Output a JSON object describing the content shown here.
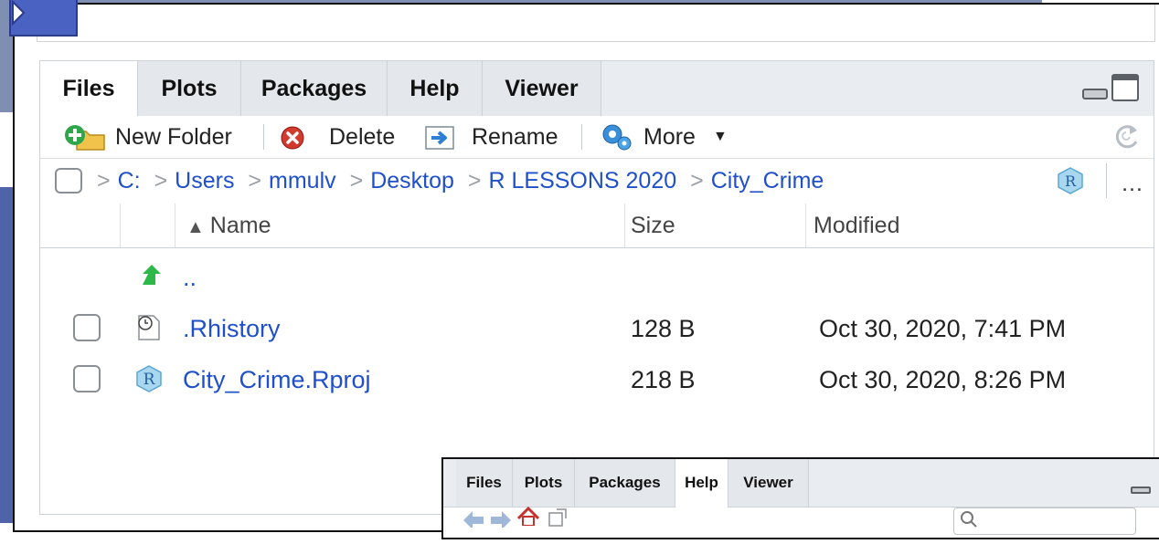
{
  "files_pane": {
    "tabs": [
      {
        "label": "Files",
        "active": true
      },
      {
        "label": "Plots",
        "active": false
      },
      {
        "label": "Packages",
        "active": false
      },
      {
        "label": "Help",
        "active": false
      },
      {
        "label": "Viewer",
        "active": false
      }
    ],
    "toolbar": {
      "new_folder": "New Folder",
      "delete": "Delete",
      "rename": "Rename",
      "more": "More"
    },
    "breadcrumb": [
      "C:",
      "Users",
      "mmulv",
      "Desktop",
      "R LESSONS 2020",
      "City_Crime"
    ],
    "breadcrumb_more": "…",
    "columns": {
      "name": "Name",
      "size": "Size",
      "modified": "Modified"
    },
    "parent_dir": "..",
    "files": [
      {
        "name": ".Rhistory",
        "size": "128 B",
        "modified": "Oct 30, 2020, 7:41 PM",
        "icon": "history-file-icon"
      },
      {
        "name": "City_Crime.Rproj",
        "size": "218 B",
        "modified": "Oct 30, 2020, 8:26 PM",
        "icon": "rproj-file-icon"
      }
    ]
  },
  "help_pane": {
    "tabs": [
      {
        "label": "Files",
        "active": false
      },
      {
        "label": "Plots",
        "active": false
      },
      {
        "label": "Packages",
        "active": false
      },
      {
        "label": "Help",
        "active": true
      },
      {
        "label": "Viewer",
        "active": false
      }
    ]
  },
  "colors": {
    "link": "#1f50c9",
    "accent_blue": "#4a62c2",
    "tab_bg": "#e4e8ec"
  }
}
